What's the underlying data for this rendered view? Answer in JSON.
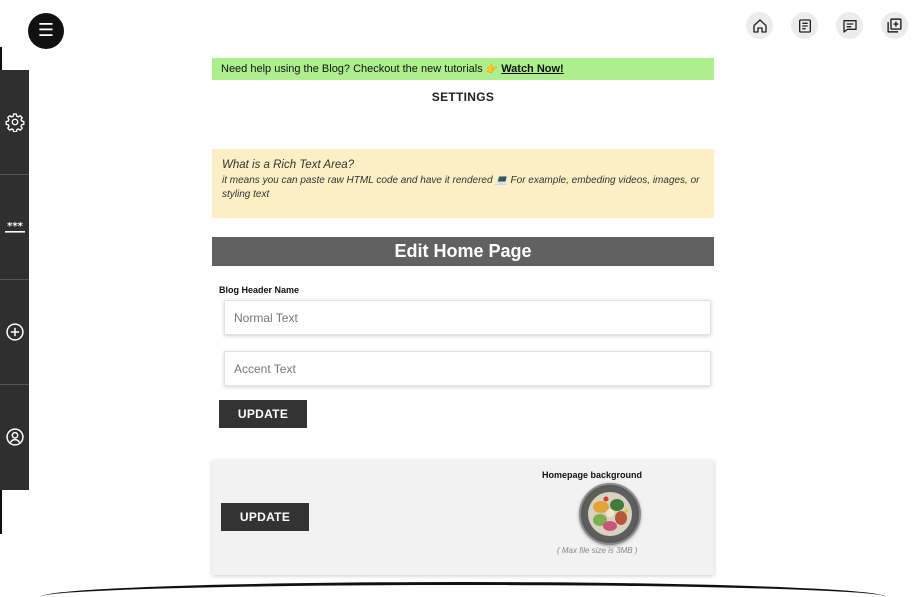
{
  "nav": {
    "menu_glyph": "☰",
    "top_icons": [
      "home-icon",
      "document-icon",
      "message-icon",
      "add-page-icon"
    ],
    "sidebar_icons": [
      "gear-icon",
      "password-icon",
      "plus-circle-icon",
      "user-circle-icon"
    ]
  },
  "help_banner": {
    "text": "Need help using the Blog? Checkout the new tutorials",
    "emoji": "👉",
    "link": "Watch Now!",
    "color": "#aeef8d"
  },
  "settings_heading": "SETTINGS",
  "rich_text_info": {
    "question": "What is a Rich Text Area?",
    "answer": "it means you can paste raw HTML code and have it rendered 💻 For example, embeding videos, images, or styling text",
    "color": "#fcefc5"
  },
  "edit_section": {
    "title": "Edit Home Page",
    "field_label": "Blog Header Name",
    "normal_placeholder": "Normal Text",
    "accent_placeholder": "Accent Text",
    "update_label": "UPDATE"
  },
  "background_section": {
    "update_label": "UPDATE",
    "label": "Homepage background",
    "note": "( Max file size is 3MB )"
  }
}
